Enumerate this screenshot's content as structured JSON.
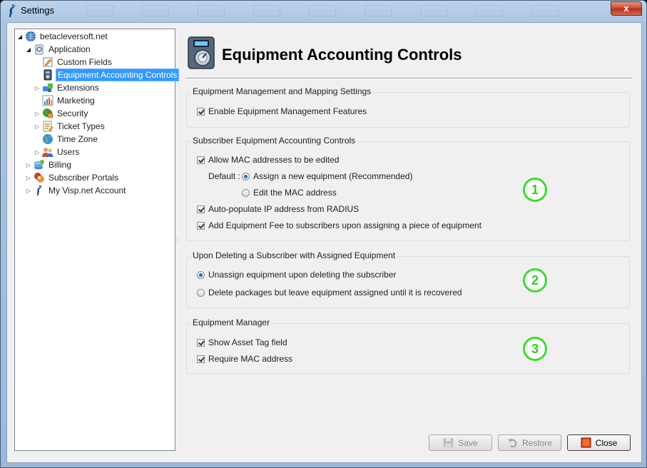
{
  "window": {
    "title": "Settings",
    "close_glyph": "x"
  },
  "tree": {
    "items": [
      {
        "label": "betacleversoft.net",
        "icon": "globe-icon"
      },
      {
        "label": "Application",
        "icon": "application-icon"
      },
      {
        "label": "Custom Fields",
        "icon": "custom-fields-icon"
      },
      {
        "label": "Equipment Accounting Controls",
        "icon": "equipment-icon"
      },
      {
        "label": "Extensions",
        "icon": "extensions-icon"
      },
      {
        "label": "Marketing",
        "icon": "marketing-chart-icon"
      },
      {
        "label": "Security",
        "icon": "security-icon"
      },
      {
        "label": "Ticket Types",
        "icon": "ticket-types-icon"
      },
      {
        "label": "Time Zone",
        "icon": "time-zone-globe-icon"
      },
      {
        "label": "Users",
        "icon": "users-icon"
      },
      {
        "label": "Billing",
        "icon": "billing-icon"
      },
      {
        "label": "Subscriber Portals",
        "icon": "subscriber-portals-icon"
      },
      {
        "label": "My Visp.net Account",
        "icon": "visp-logo-icon"
      }
    ]
  },
  "page": {
    "title": "Equipment Accounting Controls",
    "header_icon": "equipment-dial-icon"
  },
  "groups": {
    "mapping": {
      "caption": "Equipment Management and Mapping Settings",
      "enable_label": "Enable Equipment Management Features",
      "enable_checked": true
    },
    "accounting": {
      "caption": "Subscriber Equipment Accounting Controls",
      "allow_mac_label": "Allow MAC addresses to be edited",
      "allow_mac_checked": true,
      "default_label": "Default :",
      "assign_new_label": "Assign a new equipment (Recommended)",
      "assign_new_selected": true,
      "edit_mac_label": "Edit the MAC address",
      "edit_mac_selected": false,
      "auto_ip_label": "Auto-populate IP address from RADIUS",
      "auto_ip_checked": true,
      "add_fee_label": "Add Equipment Fee to subscribers upon assigning a piece of equipment",
      "add_fee_checked": true,
      "badge": "1"
    },
    "deleting": {
      "caption": "Upon Deleting a Subscriber with Assigned Equipment",
      "unassign_label": "Unassign equipment upon deleting the subscriber",
      "unassign_selected": true,
      "delete_packages_label": "Delete packages but leave equipment assigned until it is recovered",
      "delete_packages_selected": false,
      "badge": "2"
    },
    "manager": {
      "caption": "Equipment Manager",
      "asset_tag_label": "Show Asset Tag field",
      "asset_tag_checked": true,
      "require_mac_label": "Require MAC address",
      "require_mac_checked": true,
      "badge": "3"
    }
  },
  "buttons": {
    "save": "Save",
    "restore": "Restore",
    "close": "Close"
  },
  "colors": {
    "selection": "#3399ff",
    "badge_green": "#3ddc2f",
    "close_red": "#c8442c"
  }
}
